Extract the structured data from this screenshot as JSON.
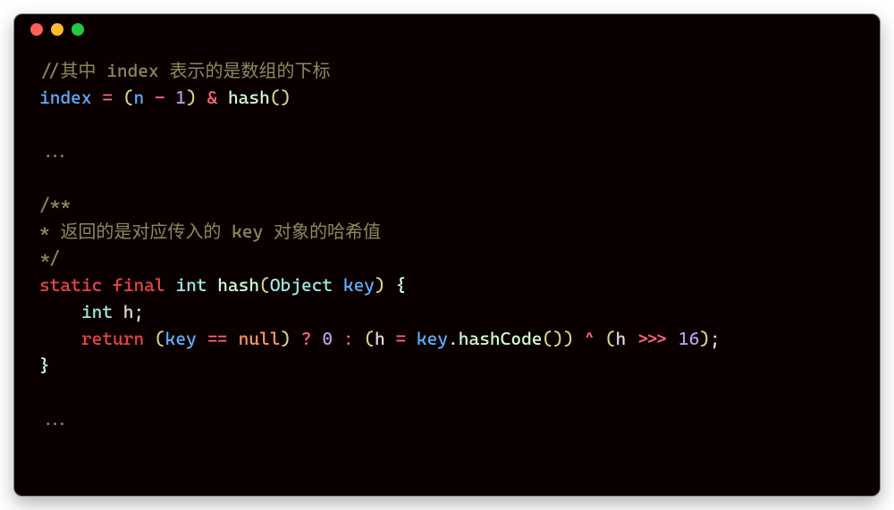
{
  "code": {
    "comment1": "//其中 index 表示的是数组的下标",
    "line2": {
      "index": "index",
      "eq": " = ",
      "lparen": "(",
      "n": "n",
      "minus": " - ",
      "one": "1",
      "rparen": ")",
      "amp": " & ",
      "hash": "hash",
      "call": "()"
    },
    "ellipsis1": "...",
    "doc_open": "/**",
    "doc_line": "* 返回的是对应传入的 key 对象的哈希值",
    "doc_close": "*/",
    "sig": {
      "static": "static",
      "final": "final",
      "int": "int",
      "hash": "hash",
      "lparen": "(",
      "Object": "Object",
      "key": "key",
      "rparen": ")",
      "brace": " {"
    },
    "body1": {
      "indent": "    ",
      "int": "int",
      "h": " h",
      "semi": ";"
    },
    "body2": {
      "indent": "    ",
      "return": "return",
      "sp": " ",
      "lparen1": "(",
      "key": "key",
      "eqeq": " == ",
      "null": "null",
      "rparen1": ")",
      "q": " ? ",
      "zero": "0",
      "colon": " : ",
      "lparen2": "(",
      "h": "h",
      "assign": " = ",
      "key2": "key",
      "dot": ".",
      "hashCode": "hashCode",
      "call": "()",
      "rparen2": ")",
      "xor": " ^ ",
      "lparen3": "(",
      "h2": "h",
      "shr": " >>> ",
      "sixteen": "16",
      "rparen3": ")",
      "semi": ";"
    },
    "brace_close": "}",
    "ellipsis2": "..."
  }
}
